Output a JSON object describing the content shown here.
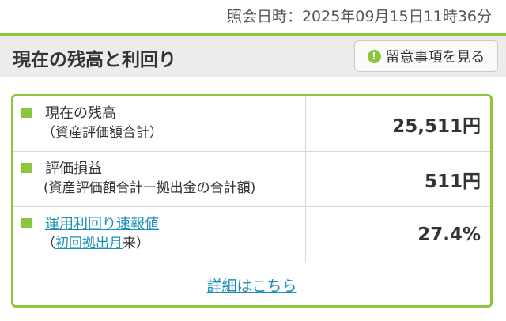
{
  "header": {
    "timestamp": "照会日時：2025年09月15日11時36分"
  },
  "section": {
    "title": "現在の残高と利回り",
    "notes_button": "留意事項を見る",
    "notes_icon": "!"
  },
  "rows": [
    {
      "label": "現在の残高",
      "sub": "（資産評価額合計）",
      "value": "25,511円"
    },
    {
      "label": "評価損益",
      "sub": "(資産評価額合計ー拠出金の合計額)",
      "value": "511円"
    },
    {
      "label": "運用利回り速報値",
      "sub_prefix": "（",
      "sub_link": "初回拠出月",
      "sub_suffix": "来）",
      "value": "27.4%"
    }
  ],
  "footer": {
    "details_link": "詳細はこちら"
  },
  "colors": {
    "accent": "#8cc63f",
    "link": "#1a8fb5"
  }
}
